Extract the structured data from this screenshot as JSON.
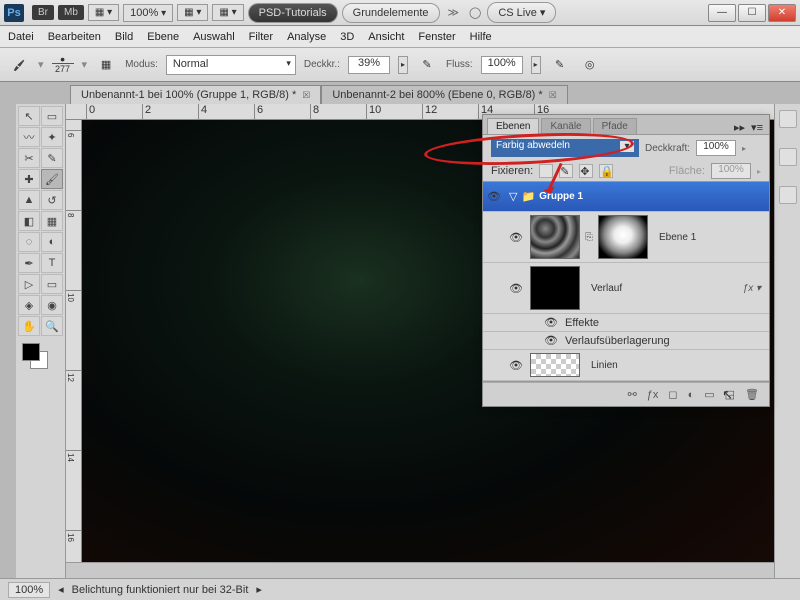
{
  "titlebar": {
    "ps": "Ps",
    "ext": [
      "Br",
      "Mb"
    ],
    "zoom": "100%",
    "tutorial": "PSD-Tutorials",
    "doc": "Grundelemente",
    "cslive": "CS Live"
  },
  "menu": [
    "Datei",
    "Bearbeiten",
    "Bild",
    "Ebene",
    "Auswahl",
    "Filter",
    "Analyse",
    "3D",
    "Ansicht",
    "Fenster",
    "Hilfe"
  ],
  "optbar": {
    "brush_size": "277",
    "modus_label": "Modus:",
    "modus_value": "Normal",
    "deck_label": "Deckkr.:",
    "deck_value": "39%",
    "fluss_label": "Fluss:",
    "fluss_value": "100%"
  },
  "tabs": [
    {
      "label": "Unbenannt-1 bei 100% (Gruppe 1, RGB/8) *"
    },
    {
      "label": "Unbenannt-2 bei 800% (Ebene 0, RGB/8) *"
    }
  ],
  "ruler_h": [
    "0",
    "2",
    "4",
    "6",
    "8",
    "10",
    "12",
    "14",
    "16"
  ],
  "ruler_v": [
    "6",
    "8",
    "10",
    "12",
    "14",
    "16"
  ],
  "panel": {
    "tabs": [
      "Ebenen",
      "Kanäle",
      "Pfade"
    ],
    "blend": "Farbig abwedeln",
    "opacity_label": "Deckkraft:",
    "opacity_value": "100%",
    "fix_label": "Fixieren:",
    "fill_label": "Fläche:",
    "fill_value": "100%",
    "group": "Gruppe 1",
    "layer1": "Ebene 1",
    "layer2": "Verlauf",
    "effects": "Effekte",
    "effect1": "Verlaufsüberlagerung",
    "layer3": "Linien"
  },
  "status": {
    "zoom": "100%",
    "msg": "Belichtung funktioniert nur bei 32-Bit"
  }
}
